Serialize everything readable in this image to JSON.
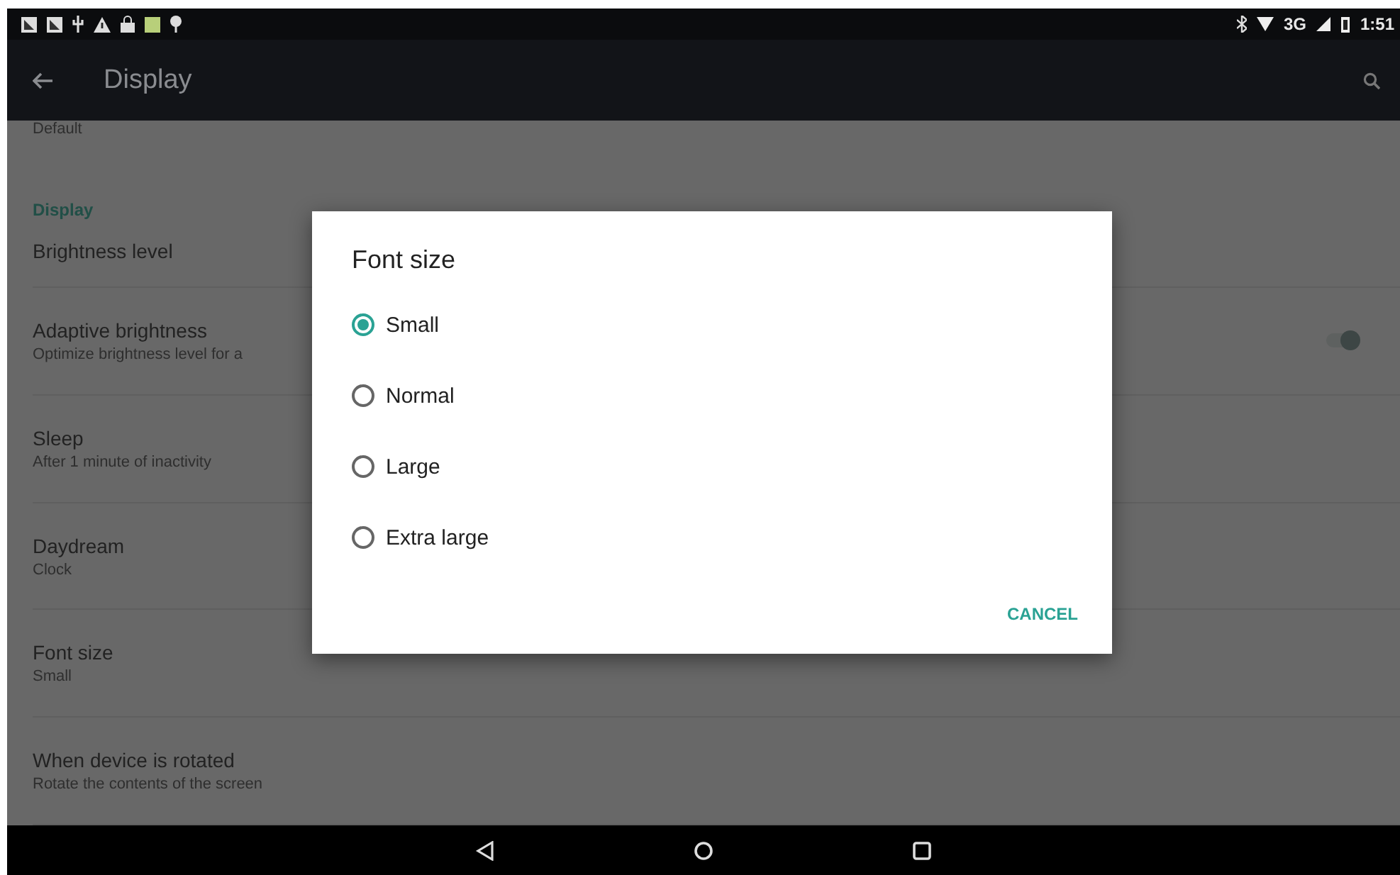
{
  "status_bar": {
    "network": "3G",
    "time": "1:51"
  },
  "app_bar": {
    "title": "Display"
  },
  "list": {
    "top_summary": "Default",
    "category": "Display",
    "items": [
      {
        "kind": "plain",
        "title": "Brightness level"
      },
      {
        "kind": "switch",
        "title": "Adaptive brightness",
        "summary": "Optimize brightness level for a",
        "on": true
      },
      {
        "kind": "plain",
        "title": "Sleep",
        "summary": "After 1 minute of inactivity"
      },
      {
        "kind": "plain",
        "title": "Daydream",
        "summary": "Clock"
      },
      {
        "kind": "plain",
        "title": "Font size",
        "summary": "Small"
      },
      {
        "kind": "plain",
        "title": "When device is rotated",
        "summary": "Rotate the contents of the screen"
      }
    ]
  },
  "dialog": {
    "title": "Font size",
    "options": [
      {
        "label": "Small",
        "selected": true
      },
      {
        "label": "Normal",
        "selected": false
      },
      {
        "label": "Large",
        "selected": false
      },
      {
        "label": "Extra large",
        "selected": false
      }
    ],
    "button": "CANCEL"
  }
}
